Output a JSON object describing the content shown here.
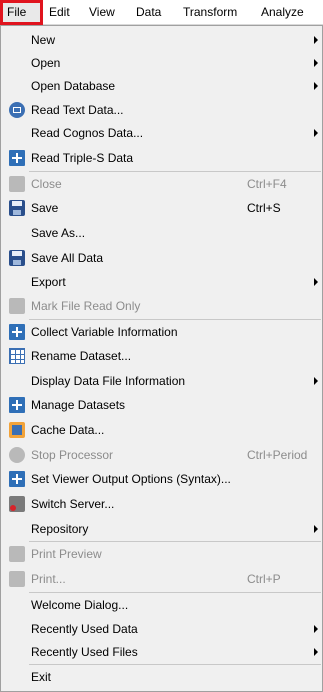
{
  "menubar": {
    "items": [
      {
        "label": "File",
        "active": true
      },
      {
        "label": "Edit"
      },
      {
        "label": "View"
      },
      {
        "label": "Data"
      },
      {
        "label": "Transform"
      },
      {
        "label": "Analyze"
      }
    ]
  },
  "menu": {
    "items": [
      {
        "label": "New",
        "submenu": true
      },
      {
        "label": "Open",
        "submenu": true
      },
      {
        "label": "Open Database",
        "submenu": true
      },
      {
        "label": "Read Text Data...",
        "icon": "read-text-data-icon"
      },
      {
        "label": "Read Cognos Data...",
        "submenu": true
      },
      {
        "label": "Read Triple-S Data",
        "icon": "plus-icon"
      },
      {
        "label": "Close",
        "shortcut": "Ctrl+F4",
        "disabled": true,
        "icon": "folder-icon"
      },
      {
        "label": "Save",
        "shortcut": "Ctrl+S",
        "icon": "floppy-icon"
      },
      {
        "label": "Save As..."
      },
      {
        "label": "Save All Data",
        "icon": "save-all-icon"
      },
      {
        "label": "Export",
        "submenu": true
      },
      {
        "label": "Mark File Read Only",
        "disabled": true,
        "icon": "mark-read-only-icon"
      },
      {
        "label": "Collect Variable Information",
        "icon": "plus-icon"
      },
      {
        "label": "Rename Dataset...",
        "icon": "rename-dataset-icon"
      },
      {
        "label": "Display Data File Information",
        "submenu": true
      },
      {
        "label": "Manage Datasets",
        "icon": "plus-icon"
      },
      {
        "label": "Cache Data...",
        "icon": "cache-data-icon"
      },
      {
        "label": "Stop Processor",
        "shortcut": "Ctrl+Period",
        "disabled": true,
        "icon": "stop-icon"
      },
      {
        "label": "Set Viewer Output Options (Syntax)...",
        "icon": "plus-icon"
      },
      {
        "label": "Switch Server...",
        "icon": "switch-server-icon"
      },
      {
        "label": "Repository",
        "submenu": true
      },
      {
        "label": "Print Preview",
        "disabled": true,
        "icon": "print-preview-icon"
      },
      {
        "label": "Print...",
        "shortcut": "Ctrl+P",
        "disabled": true,
        "icon": "printer-icon"
      },
      {
        "label": "Welcome Dialog..."
      },
      {
        "label": "Recently Used Data",
        "submenu": true
      },
      {
        "label": "Recently Used Files",
        "submenu": true
      },
      {
        "label": "Exit"
      }
    ]
  }
}
